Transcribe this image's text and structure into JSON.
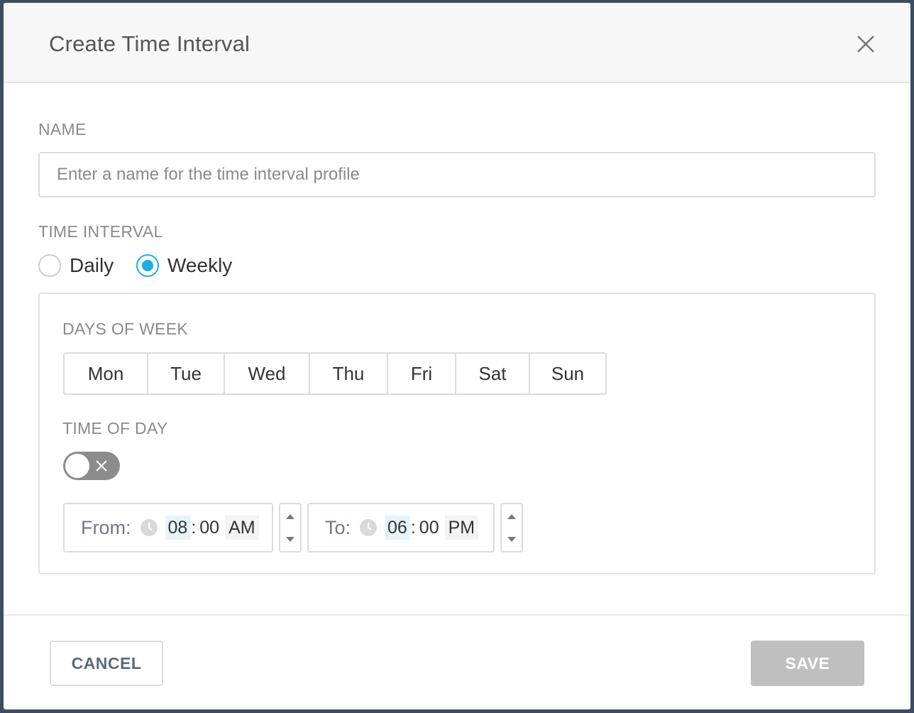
{
  "dialog": {
    "title": "Create Time Interval",
    "close_icon": "close-icon"
  },
  "name_section": {
    "label": "NAME",
    "placeholder": "Enter a name for the time interval profile",
    "value": ""
  },
  "interval_section": {
    "label": "TIME INTERVAL",
    "options": [
      {
        "label": "Daily",
        "selected": false
      },
      {
        "label": "Weekly",
        "selected": true
      }
    ]
  },
  "weekly": {
    "days_label": "DAYS OF WEEK",
    "days": [
      "Mon",
      "Tue",
      "Wed",
      "Thu",
      "Fri",
      "Sat",
      "Sun"
    ],
    "time_of_day_label": "TIME OF DAY",
    "time_of_day_enabled": false,
    "from": {
      "prefix": "From:",
      "hour": "08",
      "minute": "00",
      "ampm": "AM"
    },
    "to": {
      "prefix": "To:",
      "hour": "06",
      "minute": "00",
      "ampm": "PM"
    }
  },
  "footer": {
    "cancel_label": "CANCEL",
    "save_label": "SAVE"
  },
  "colors": {
    "accent": "#1ab0e2",
    "toggle_off": "#8c8c8c",
    "save_disabled": "#bfbfbf"
  }
}
